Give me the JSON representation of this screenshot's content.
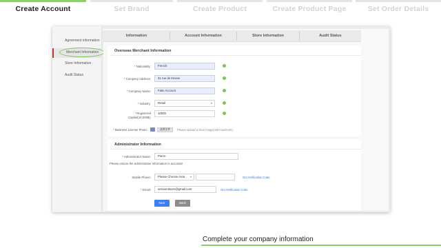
{
  "steps": [
    {
      "label": "Create Account",
      "active": true
    },
    {
      "label": "Set Brand",
      "active": false
    },
    {
      "label": "Create Product",
      "active": false
    },
    {
      "label": "Create Product Page",
      "active": false
    },
    {
      "label": "Set Order Details",
      "active": false
    }
  ],
  "sidebar": {
    "items": [
      {
        "label": "Agreement information"
      },
      {
        "label": "Merchant Information",
        "active": true
      },
      {
        "label": "Store Information"
      },
      {
        "label": "Audit Status"
      }
    ]
  },
  "tabs": [
    {
      "label": "Information"
    },
    {
      "label": "Account Information"
    },
    {
      "label": "Store Information"
    },
    {
      "label": "Audit Status"
    }
  ],
  "merchant_section": {
    "title": "Overseas Merchant Information",
    "fields": {
      "nationality": {
        "label": "Nationality:",
        "value": "French"
      },
      "address": {
        "label": "Company Address:",
        "value": "31 rue de trevise"
      },
      "company_name": {
        "label": "Company Name:",
        "value": "Fake Account"
      },
      "industry": {
        "label": "Industry:",
        "value": "Retail"
      },
      "capital": {
        "label_line1": "Registered",
        "label_line2": "Capital(10,000$):",
        "value": "10000"
      },
      "license": {
        "label": "Business License Photo:",
        "button": "选择文件",
        "hint": "Please upload a clear image(1M maximum)"
      }
    }
  },
  "admin_section": {
    "title": "Administrator Information",
    "admin_name": {
      "label": "Administrator Name:",
      "value": "Pierre"
    },
    "note": "Please ensure the administrator information is accurate!",
    "mobile": {
      "label": "Mobile Phone:",
      "code_placeholder": "Please Choose Area",
      "link": "Get Verification Code"
    },
    "email": {
      "label": "Email:",
      "value": "sessiontlourn@gmail.com",
      "link": "Get Verification Code"
    }
  },
  "buttons": {
    "next": "Next",
    "back": "Back"
  },
  "caption": "Complete your company information",
  "colors": {
    "accent_green": "#8fce6e",
    "button_blue": "#3d7ff0",
    "required_red": "#d9534f"
  }
}
